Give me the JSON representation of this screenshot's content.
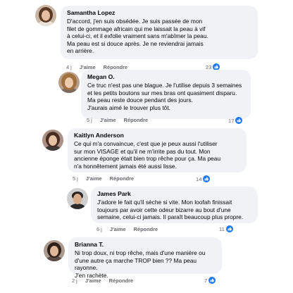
{
  "comments": [
    {
      "author": "Samantha Lopez",
      "text": "D'accord, j'en suis obsédée. Je suis passée de mon\nfilet de gommage africain qui me laissait la peau à vif\nà celui-ci, et il exfolie vraiment sans m'abîmer la peau.\nMa peau est si douce après. Je ne reviendrai jamais\nen arrière.",
      "time": "4 j",
      "like_label": "J'aime",
      "reply_label": "Répondre",
      "reactions": "23"
    },
    {
      "author": "Megan O.",
      "text": "Ce truc n'est pas une blague. Je l'utilise depuis 3 semaines\net les petits boutons sur mes bras ont quasiment disparu.\nMa peau reste douce pendant des jours.\nJ'aurais aimé le trouver plus tôt.",
      "time": "5 j",
      "like_label": "J'aime",
      "reply_label": "Répondre",
      "reactions": "17"
    },
    {
      "author": "Kaitlyn Anderson",
      "text": "Ce qui m'a convaincue, c'est que je peux aussi l'utiliser\nsur mon VISAGE et qu'il ne m'irrite pas du tout. Mon\nancienne éponge était bien trop rêche pour ça. Ma peau\nn'a honnêtement jamais été aussi lisse.",
      "time": "5 j",
      "like_label": "J'aime",
      "reply_label": "Répondre",
      "reactions": "14"
    },
    {
      "author": "James Park",
      "text": "J'adore le fait qu'il sèche si vite. Mon loofah finissait\ntoujours par avoir cette odeur bizarre au bout d'une\nsemaine, celui-ci jamais. Il paraît beaucoup plus propre.",
      "time": "6 j",
      "like_label": "J'aime",
      "reply_label": "Répondre",
      "reactions": "11"
    },
    {
      "author": "Brianna T.",
      "text": "Ni trop doux, ni trop rêche, mais d'une manière ou\nd'une autre ça marche TROP bien ?? Ma peau rayonne.\nJ'en rachète.",
      "time": "2 j",
      "like_label": "J'aime",
      "reply_label": "Répondre",
      "reactions": "7"
    }
  ]
}
